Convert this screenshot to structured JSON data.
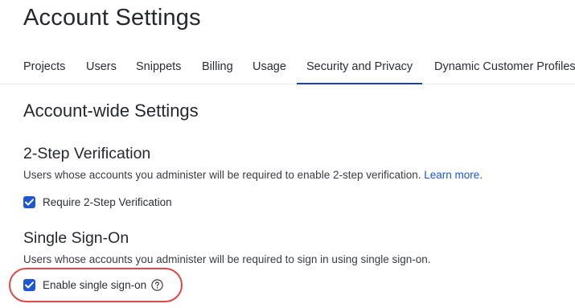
{
  "page": {
    "title": "Account Settings"
  },
  "tabs": [
    {
      "label": "Projects",
      "active": false
    },
    {
      "label": "Users",
      "active": false
    },
    {
      "label": "Snippets",
      "active": false
    },
    {
      "label": "Billing",
      "active": false
    },
    {
      "label": "Usage",
      "active": false
    },
    {
      "label": "Security and Privacy",
      "active": true
    },
    {
      "label": "Dynamic Customer Profiles",
      "active": false
    }
  ],
  "main": {
    "section_title": "Account-wide Settings",
    "two_step": {
      "title": "2-Step Verification",
      "description": "Users whose accounts you administer will be required to enable 2-step verification.",
      "learn_more": "Learn more",
      "learn_more_suffix": ".",
      "checkbox_label": "Require 2-Step Verification",
      "checked": true
    },
    "sso": {
      "title": "Single Sign-On",
      "description": "Users whose accounts you administer will be required to sign in using single sign-on.",
      "checkbox_label": "Enable single sign-on",
      "checked": true,
      "help_icon": "question-circle-icon"
    }
  },
  "colors": {
    "accent": "#1f56d1",
    "active_tab_underline": "#1a3fbf",
    "link": "#1a56db",
    "highlight_ring": "#e04848"
  }
}
